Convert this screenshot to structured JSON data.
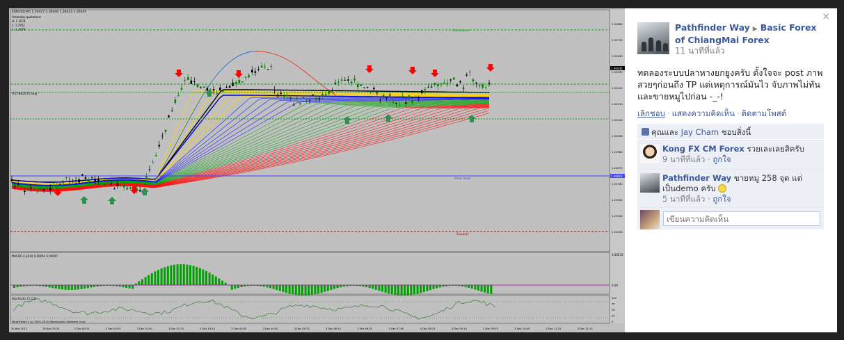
{
  "chart": {
    "symbol_header": "EURUSD.M5  1.30427 1.30446 1.30423 1.30430",
    "info_lines": [
      "Yesterday quotations",
      "H: 1.3074",
      "L: 1.2952",
      "C: 1.3070"
    ],
    "order_label": "#27862072 buy",
    "level_labels": {
      "resistance": "Resistance",
      "pivot": "Pivot level",
      "support": "Support"
    },
    "price_ticks": [
      "1.30860",
      "1.30750",
      "1.30640",
      "1.30530",
      "1.30420",
      "1.30310",
      "1.30200",
      "1.30090",
      "1.29980",
      "1.29870",
      "1.29760",
      "1.29650",
      "1.29540",
      "1.29430"
    ],
    "current_price": "1.30430",
    "pivot_price": "1.30010",
    "macd_label": "MACD(12,26,9) 0.00054 0.00007",
    "macd_ticks": [
      "0.00233",
      "0.00"
    ],
    "stoch_label": "Stochastic (5,3,3)",
    "stoch_ticks": [
      "100",
      "75",
      "50",
      "25",
      "0"
    ],
    "time_labels": [
      "30 Nov 2012",
      "30 Nov 23:25",
      "3 Dec 00:10",
      "3 Dec 00:55",
      "3 Dec 01:40",
      "3 Dec 02:25",
      "3 Dec 03:10",
      "3 Dec 03:55",
      "3 Dec 04:40",
      "3 Dec 05:25",
      "3 Dec 06:10",
      "3 Dec 06:55",
      "3 Dec 07:40",
      "3 Dec 08:25",
      "3 Dec 09:10",
      "3 Dec 09:55",
      "3 Dec 10:40",
      "3 Dec 11:25",
      "3 Dec 12:10"
    ],
    "copyright": "MetaTrader 4 (c) 2001-2012 MetaQuotes Software Corp.",
    "colors": {
      "bg": "#c0c0c0",
      "bull": "#008000",
      "bear": "#ff0000",
      "ribbon_red": "#ff0000",
      "ribbon_green": "#00a000",
      "ribbon_blue": "#0000ff",
      "ribbon_yellow": "#ffd700"
    }
  },
  "post": {
    "author": "Pathfinder Way",
    "group": "Basic Forex of ChiangMai Forex",
    "time": "11 นาทีที่แล้ว",
    "body": "ทดลองระบบปลาหางยกยูงครับ ตั้งใจจะ post ภาพสวยๆก่อนถึง TP แต่เหตุการณ์มันไว จับภาพไม่ทันและขายหมูไปก่อน -_-!",
    "action_unlike": "เลิกชอบ",
    "action_comment": "แสดงความคิดเห็น",
    "action_follow": "ติดตามโพสต์",
    "likes_prefix": "คุณและ",
    "likes_person": "Jay Cham",
    "likes_suffix": "ชอบสิ่งนี้",
    "comments": [
      {
        "name": "Kong FX CM Forex",
        "text": "รวยเละเลยสิครับ",
        "time": "9 นาทีที่แล้ว",
        "like": "ถูกใจ"
      },
      {
        "name": "Pathfinder Way",
        "text": "ขายหมู 258 จุด แต่เป็นdemo ครับ",
        "time": "5 นาทีที่แล้ว",
        "like": "ถูกใจ"
      }
    ],
    "comment_placeholder": "เขียนความคิดเห็น",
    "close_glyph": "×"
  }
}
